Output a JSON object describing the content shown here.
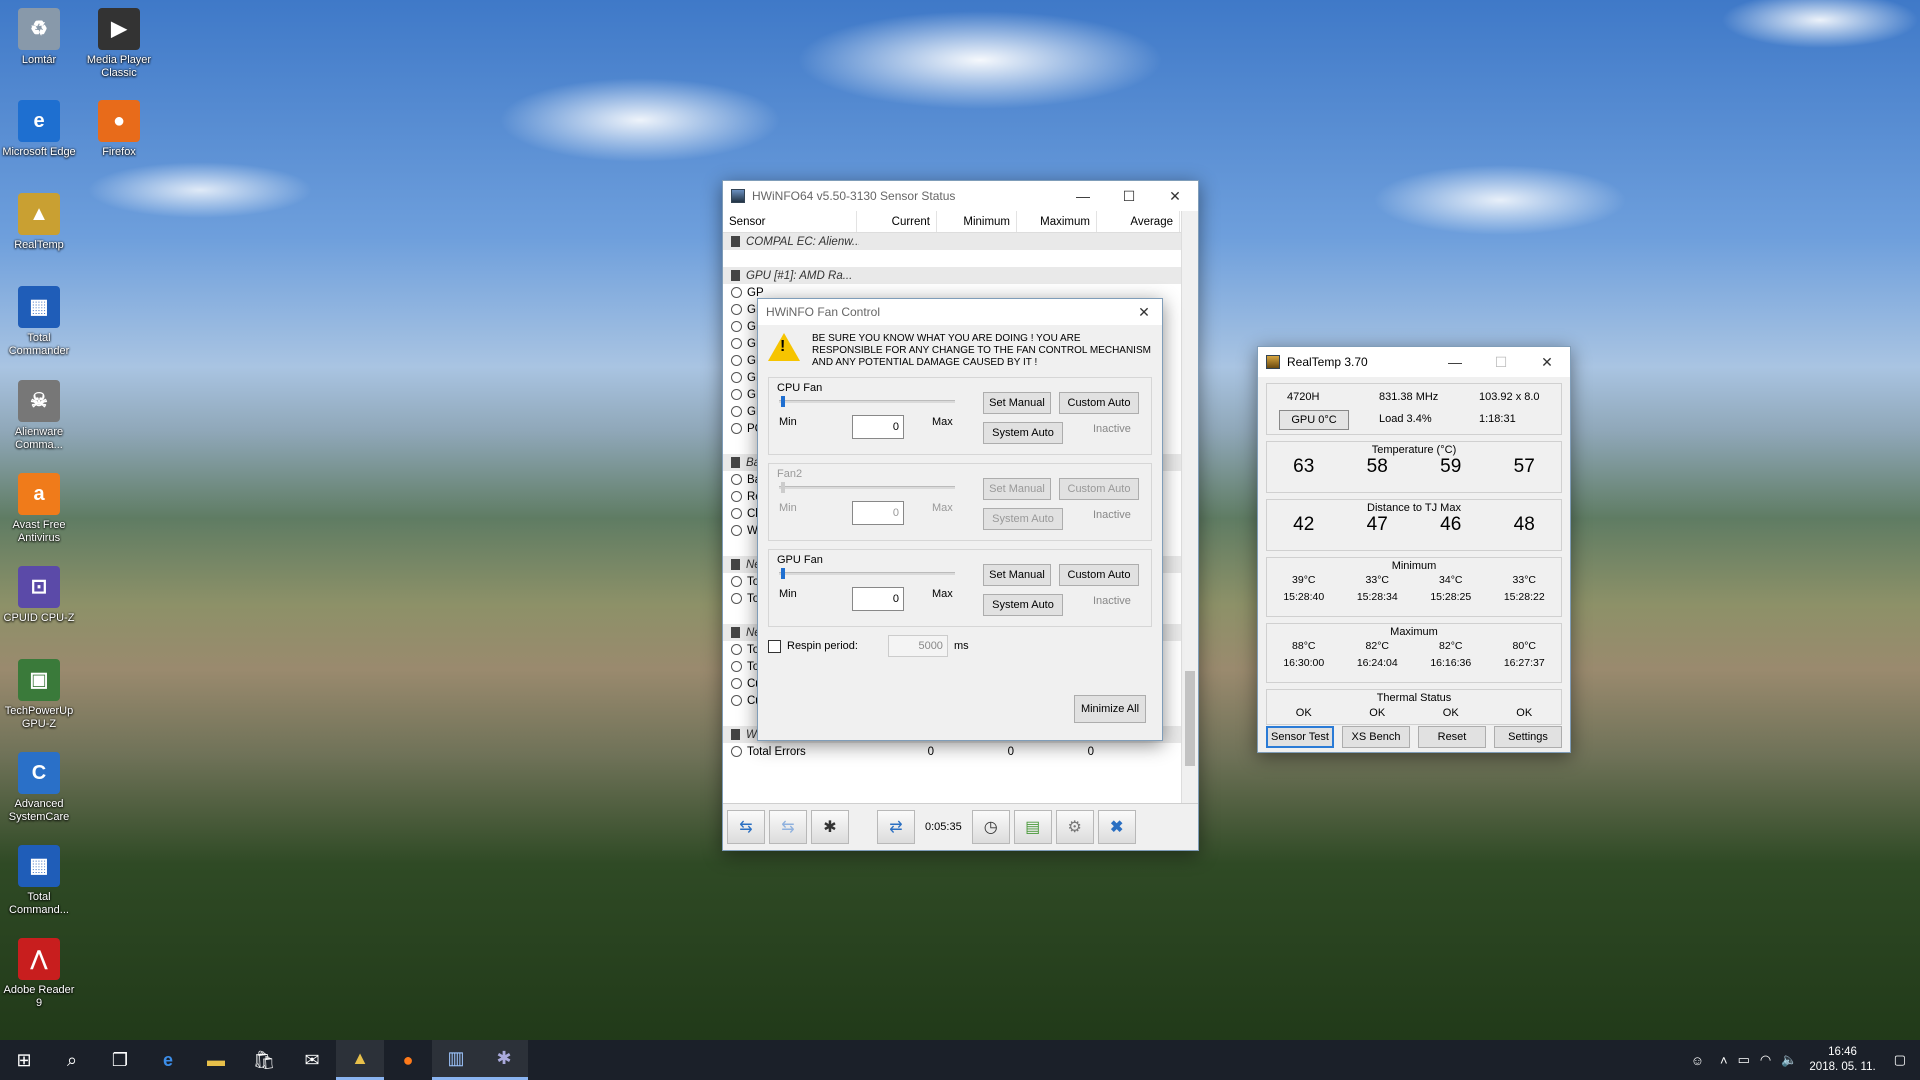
{
  "desktop": {
    "icons": [
      {
        "label": "Lomtár",
        "icon": "recycle-bin-icon"
      },
      {
        "label": "Media Player Classic",
        "icon": "media-player-icon"
      },
      {
        "label": "Microsoft Edge",
        "icon": "edge-icon"
      },
      {
        "label": "Firefox",
        "icon": "firefox-icon"
      },
      {
        "label": "RealTemp",
        "icon": "realtemp-icon"
      },
      {
        "label": "Total Commander",
        "icon": "total-commander-icon"
      },
      {
        "label": "Alienware Comma...",
        "icon": "alienware-icon"
      },
      {
        "label": "Avast Free Antivirus",
        "icon": "avast-icon"
      },
      {
        "label": "CPUID CPU-Z",
        "icon": "cpuz-icon"
      },
      {
        "label": "TechPowerUp GPU-Z",
        "icon": "gpuz-icon"
      },
      {
        "label": "Advanced SystemCare",
        "icon": "systemcare-icon"
      },
      {
        "label": "Total Command...",
        "icon": "total-commander-icon"
      },
      {
        "label": "Adobe Reader 9",
        "icon": "adobe-reader-icon"
      }
    ]
  },
  "hwinfo": {
    "title": "HWiNFO64 v5.50-3130 Sensor Status",
    "columns": [
      "Sensor",
      "Current",
      "Minimum",
      "Maximum",
      "Average"
    ],
    "rows": [
      {
        "type": "group",
        "name": "COMPAL EC: Alienw...",
        "c": "",
        "mn": "",
        "mx": ""
      },
      {
        "type": "spacer",
        "name": "",
        "c": "",
        "mn": "",
        "mx": ""
      },
      {
        "type": "group",
        "name": "GPU [#1]: AMD Ra...",
        "c": "",
        "mn": "",
        "mx": ""
      },
      {
        "type": "item",
        "name": "GP",
        "c": "",
        "mn": "",
        "mx": ""
      },
      {
        "type": "item",
        "name": "GP",
        "c": "",
        "mn": "",
        "mx": ""
      },
      {
        "type": "item",
        "name": "GP",
        "c": "",
        "mn": "",
        "mx": ""
      },
      {
        "type": "item",
        "name": "GP",
        "c": "",
        "mn": "",
        "mx": ""
      },
      {
        "type": "item",
        "name": "GP",
        "c": "",
        "mn": "",
        "mx": ""
      },
      {
        "type": "item",
        "name": "GP",
        "c": "",
        "mn": "",
        "mx": ""
      },
      {
        "type": "item",
        "name": "GP",
        "c": "",
        "mn": "",
        "mx": ""
      },
      {
        "type": "item",
        "name": "GP",
        "c": "",
        "mn": "",
        "mx": ""
      },
      {
        "type": "item",
        "name": "PC",
        "c": "",
        "mn": "",
        "mx": ""
      },
      {
        "type": "spacer",
        "name": "",
        "c": "",
        "mn": "",
        "mx": ""
      },
      {
        "type": "group",
        "name": "Ba",
        "c": "",
        "mn": "",
        "mx": ""
      },
      {
        "type": "item",
        "name": "Ba",
        "c": "",
        "mn": "",
        "mx": ""
      },
      {
        "type": "item",
        "name": "Re",
        "c": "",
        "mn": "",
        "mx": ""
      },
      {
        "type": "item",
        "name": "Ch",
        "c": "",
        "mn": "",
        "mx": ""
      },
      {
        "type": "item",
        "name": "We",
        "c": "",
        "mn": "",
        "mx": ""
      },
      {
        "type": "spacer",
        "name": "",
        "c": "",
        "mn": "",
        "mx": ""
      },
      {
        "type": "group",
        "name": "Ne",
        "c": "",
        "mn": "",
        "mx": ""
      },
      {
        "type": "item",
        "name": "To",
        "c": "",
        "mn": "",
        "mx": ""
      },
      {
        "type": "item",
        "name": "To",
        "c": "",
        "mn": "",
        "mx": ""
      },
      {
        "type": "spacer",
        "name": "",
        "c": "",
        "mn": "",
        "mx": ""
      },
      {
        "type": "group",
        "name": "Ne",
        "c": "",
        "mn": "",
        "mx": ""
      },
      {
        "type": "item",
        "name": "To",
        "c": "",
        "mn": "",
        "mx": ""
      },
      {
        "type": "item",
        "name": "To",
        "c": "",
        "mn": "",
        "mx": ""
      },
      {
        "type": "item",
        "name": "Cu",
        "c": "",
        "mn": "",
        "mx": ""
      },
      {
        "type": "item",
        "name": "Cu",
        "c": "",
        "mn": "",
        "mx": ""
      },
      {
        "type": "spacer",
        "name": "",
        "c": "",
        "mn": "",
        "mx": ""
      },
      {
        "type": "group",
        "name": "Windows Hardware...",
        "c": "",
        "mn": "",
        "mx": ""
      },
      {
        "type": "item",
        "name": "Total Errors",
        "c": "0",
        "mn": "0",
        "mx": "0"
      }
    ],
    "elapsed": "0:05:35"
  },
  "fan_control": {
    "title": "HWiNFO Fan Control",
    "warning": "BE SURE YOU KNOW WHAT YOU ARE DOING ! YOU ARE RESPONSIBLE FOR ANY CHANGE TO THE FAN CONTROL MECHANISM AND ANY POTENTIAL DAMAGE CAUSED BY IT !",
    "min_label": "Min",
    "max_label": "Max",
    "set_manual": "Set Manual",
    "custom_auto": "Custom Auto",
    "system_auto": "System Auto",
    "inactive": "Inactive",
    "fans": [
      {
        "name": "CPU Fan",
        "value": "0",
        "enabled": true
      },
      {
        "name": "Fan2",
        "value": "0",
        "enabled": false
      },
      {
        "name": "GPU Fan",
        "value": "0",
        "enabled": true
      }
    ],
    "respin_label": "Respin period:",
    "respin_value": "5000",
    "respin_unit": "ms",
    "minimize_all": "Minimize All"
  },
  "realtemp": {
    "title": "RealTemp 3.70",
    "cpu": "4720H",
    "mhz": "831.38 MHz",
    "mult": "103.92 x 8.0",
    "gpu": "GPU  0°C",
    "load": "Load  3.4%",
    "time": "1:18:31",
    "temp_label": "Temperature (°C)",
    "temps": [
      "63",
      "58",
      "59",
      "57"
    ],
    "dist_label": "Distance to TJ Max",
    "dist": [
      "42",
      "47",
      "46",
      "48"
    ],
    "min_label": "Minimum",
    "min_vals": [
      "39°C",
      "33°C",
      "34°C",
      "33°C"
    ],
    "min_times": [
      "15:28:40",
      "15:28:34",
      "15:28:25",
      "15:28:22"
    ],
    "max_label": "Maximum",
    "max_vals": [
      "88°C",
      "82°C",
      "82°C",
      "80°C"
    ],
    "max_times": [
      "16:30:00",
      "16:24:04",
      "16:16:36",
      "16:27:37"
    ],
    "thermal_label": "Thermal Status",
    "thermal": [
      "OK",
      "OK",
      "OK",
      "OK"
    ],
    "buttons": [
      "Sensor Test",
      "XS Bench",
      "Reset",
      "Settings"
    ]
  },
  "taskbar": {
    "time": "16:46",
    "date": "2018. 05. 11."
  }
}
